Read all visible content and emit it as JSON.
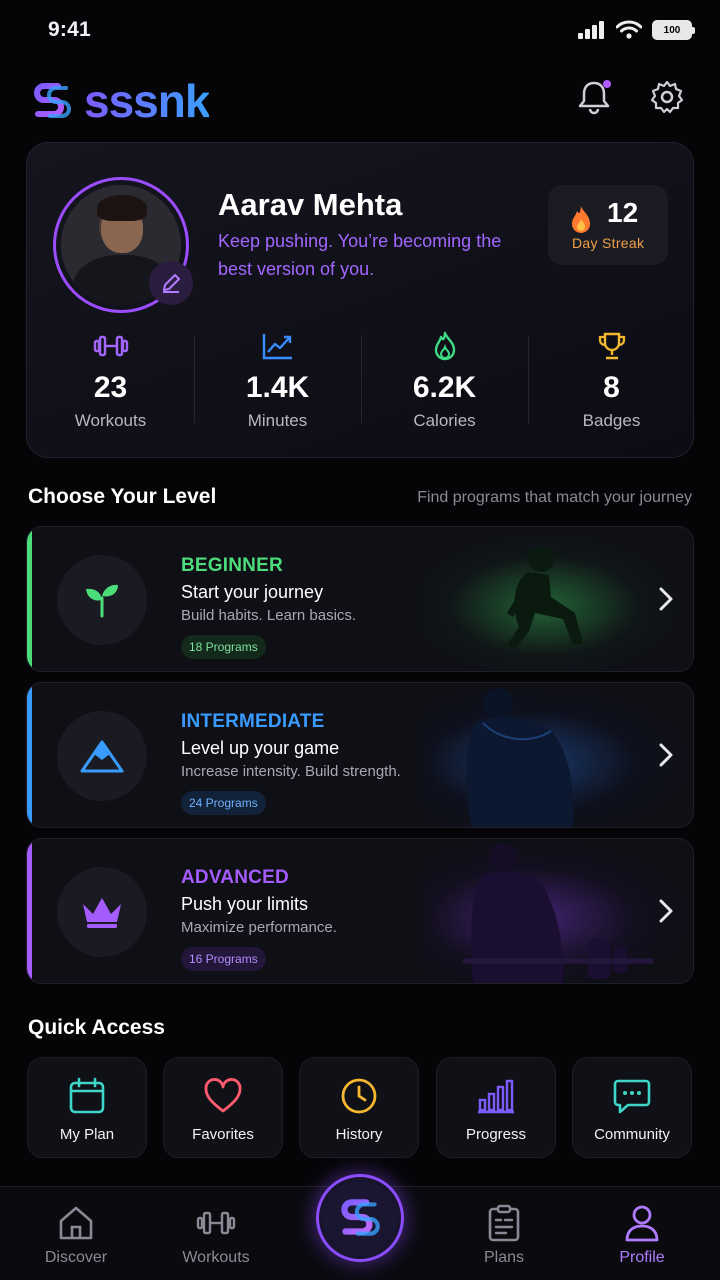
{
  "status_bar": {
    "time": "9:41",
    "battery": "100"
  },
  "header": {
    "logo_text": "sssnk"
  },
  "profile": {
    "name": "Aarav Mehta",
    "subtitle": "Keep pushing. You’re becoming the best version of you.",
    "streak": {
      "value": "12",
      "label": "Day Streak"
    },
    "stats": [
      {
        "icon": "dumbbell-icon",
        "value": "23",
        "label": "Workouts",
        "color": "#a366ff"
      },
      {
        "icon": "trend-chart-icon",
        "value": "1.4K",
        "label": "Minutes",
        "color": "#3a8dff"
      },
      {
        "icon": "flame-icon",
        "value": "6.2K",
        "label": "Calories",
        "color": "#3ddc84"
      },
      {
        "icon": "trophy-icon",
        "value": "8",
        "label": "Badges",
        "color": "#f5b82e"
      }
    ]
  },
  "levels_section": {
    "title": "Choose Your Level",
    "hint": "Find programs that match your journey"
  },
  "levels": [
    {
      "title": "BEGINNER",
      "subtitle": "Start your journey",
      "desc": "Build habits. Learn basics.",
      "programs": "18 Programs",
      "color": "#4ddc7a",
      "icon": "sprout-icon"
    },
    {
      "title": "INTERMEDIATE",
      "subtitle": "Level up your game",
      "desc": "Increase intensity. Build strength.",
      "programs": "24 Programs",
      "color": "#3a9bff",
      "icon": "mountain-icon"
    },
    {
      "title": "ADVANCED",
      "subtitle": "Push your limits",
      "desc": "Maximize performance.",
      "programs": "16 Programs",
      "color": "#a45cff",
      "icon": "crown-icon"
    }
  ],
  "quick_access": {
    "title": "Quick Access",
    "items": [
      {
        "label": "My Plan",
        "icon": "calendar-icon",
        "color": "#3dd6c9"
      },
      {
        "label": "Favorites",
        "icon": "heart-icon",
        "color": "#ff5b6e"
      },
      {
        "label": "History",
        "icon": "clock-icon",
        "color": "#f5b82e"
      },
      {
        "label": "Progress",
        "icon": "bar-chart-icon",
        "color": "#7c5cff"
      },
      {
        "label": "Community",
        "icon": "chat-icon",
        "color": "#3dd6c9"
      }
    ]
  },
  "nav": {
    "items": [
      {
        "label": "Discover",
        "icon": "home-icon",
        "active": false
      },
      {
        "label": "Workouts",
        "icon": "dumbbell-icon",
        "active": false
      },
      {
        "label": "Plans",
        "icon": "clipboard-icon",
        "active": false
      },
      {
        "label": "Profile",
        "icon": "user-icon",
        "active": true
      }
    ],
    "active_color": "#b07cff",
    "inactive_color": "#8a8a96"
  }
}
